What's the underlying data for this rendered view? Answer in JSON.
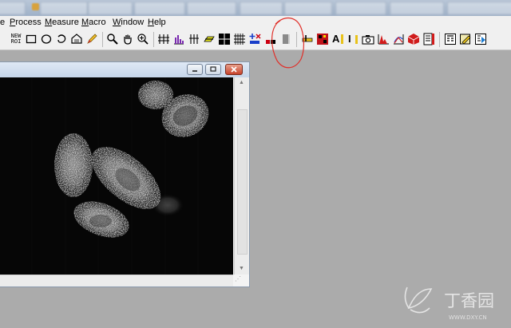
{
  "menu": {
    "items": [
      {
        "label": "e"
      },
      {
        "label": "Process"
      },
      {
        "label": "Measure"
      },
      {
        "label": "Macro"
      },
      {
        "label": "Window"
      },
      {
        "label": "Help"
      }
    ]
  },
  "toolbar": {
    "new_roi_line1": "NEW",
    "new_roi_line2": "ROI",
    "tools": [
      "rectangle-roi",
      "oval-roi",
      "freehand-roi",
      "polygon-roi",
      "pencil",
      "magnifier",
      "hand",
      "zoom",
      "line-profile",
      "histogram-lines",
      "column-profile",
      "scale-bar",
      "grid-black",
      "grid-overlay",
      "add-mark",
      "threshold",
      "gray-bar"
    ],
    "text_tool_label": "A",
    "text_tool_label2": "I"
  },
  "colors": {
    "desktop": "#ababab",
    "menubar": "#f0f0f0",
    "annotation_red": "#e0302a",
    "image_bg": "#060606"
  },
  "watermark": {
    "text": "丁香园",
    "sub": "WWW.DXY.CN"
  }
}
